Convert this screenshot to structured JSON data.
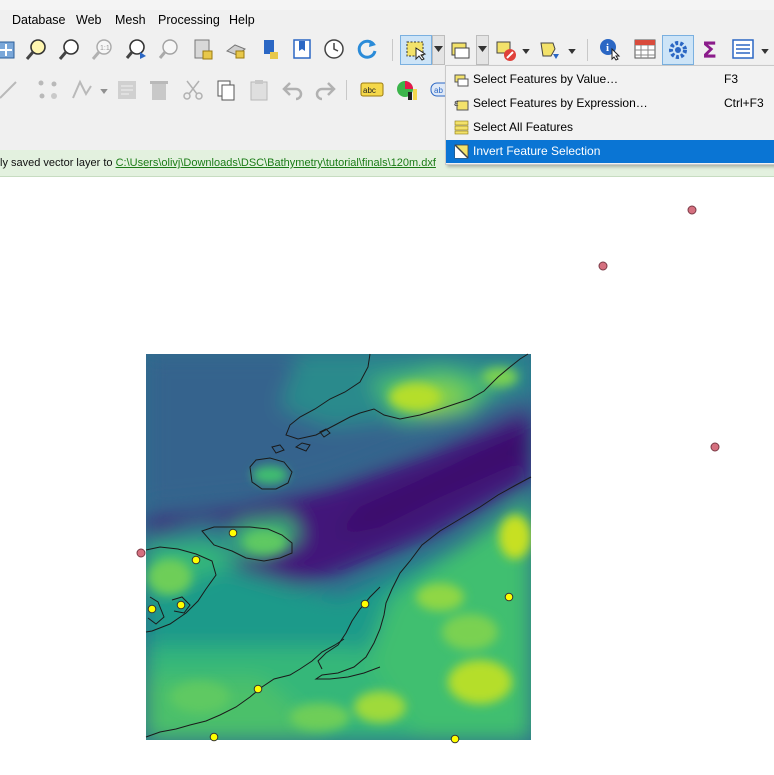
{
  "menu": [
    "Database",
    "Web",
    "Mesh",
    "Processing",
    "Help"
  ],
  "toolbar1_icons": [
    "pan-to-selection-icon",
    "zoom-in-icon",
    "zoom-out-icon",
    "zoom-native-icon",
    "zoom-to-selection-icon",
    "zoom-to-layer-icon",
    "zoom-last-icon",
    "zoom-next-icon",
    "new-bookmark-icon",
    "show-bookmarks-icon",
    "temporal-controller-icon",
    "refresh-icon",
    "select-features-icon",
    "select-by-value-icon",
    "deselect-icon",
    "select-by-location-icon",
    "identify-icon",
    "attribute-table-icon",
    "processing-toolbox-icon",
    "statistics-sigma-icon",
    "open-field-calculator-icon"
  ],
  "toolbar2_icons": [
    "digitize-icon",
    "vertex-tool-icon",
    "node-tool-icon",
    "save-edits-icon",
    "delete-selected-icon",
    "cut-features-icon",
    "copy-features-icon",
    "paste-features-icon",
    "undo-icon",
    "redo-icon",
    "label-abc-icon",
    "diagram-icon",
    "label-tool-icon"
  ],
  "message": {
    "prefix": "ly saved vector layer to ",
    "link": "C:\\Users\\olivj\\Downloads\\DSC\\Bathymetry\\tutorial\\finals\\120m.dxf"
  },
  "dropdown": {
    "items": [
      {
        "label": "Select Features by Value…",
        "shortcut": "F3",
        "icon": "select-by-value-icon"
      },
      {
        "label": "Select Features by Expression…",
        "shortcut": "Ctrl+F3",
        "icon": "select-by-expression-icon"
      },
      {
        "label": "Select All Features",
        "shortcut": "",
        "icon": "select-all-icon"
      },
      {
        "label": "Invert Feature Selection",
        "shortcut": "",
        "icon": "invert-selection-icon"
      }
    ],
    "highlighted_index": 3
  },
  "map": {
    "colors": {
      "deep": "#43127a",
      "mid": "#2a7f8d",
      "shallow": "#3fbf70",
      "high": "#c7e020",
      "yellow_point": "#ffff00",
      "red_point": "#d5707f"
    }
  }
}
